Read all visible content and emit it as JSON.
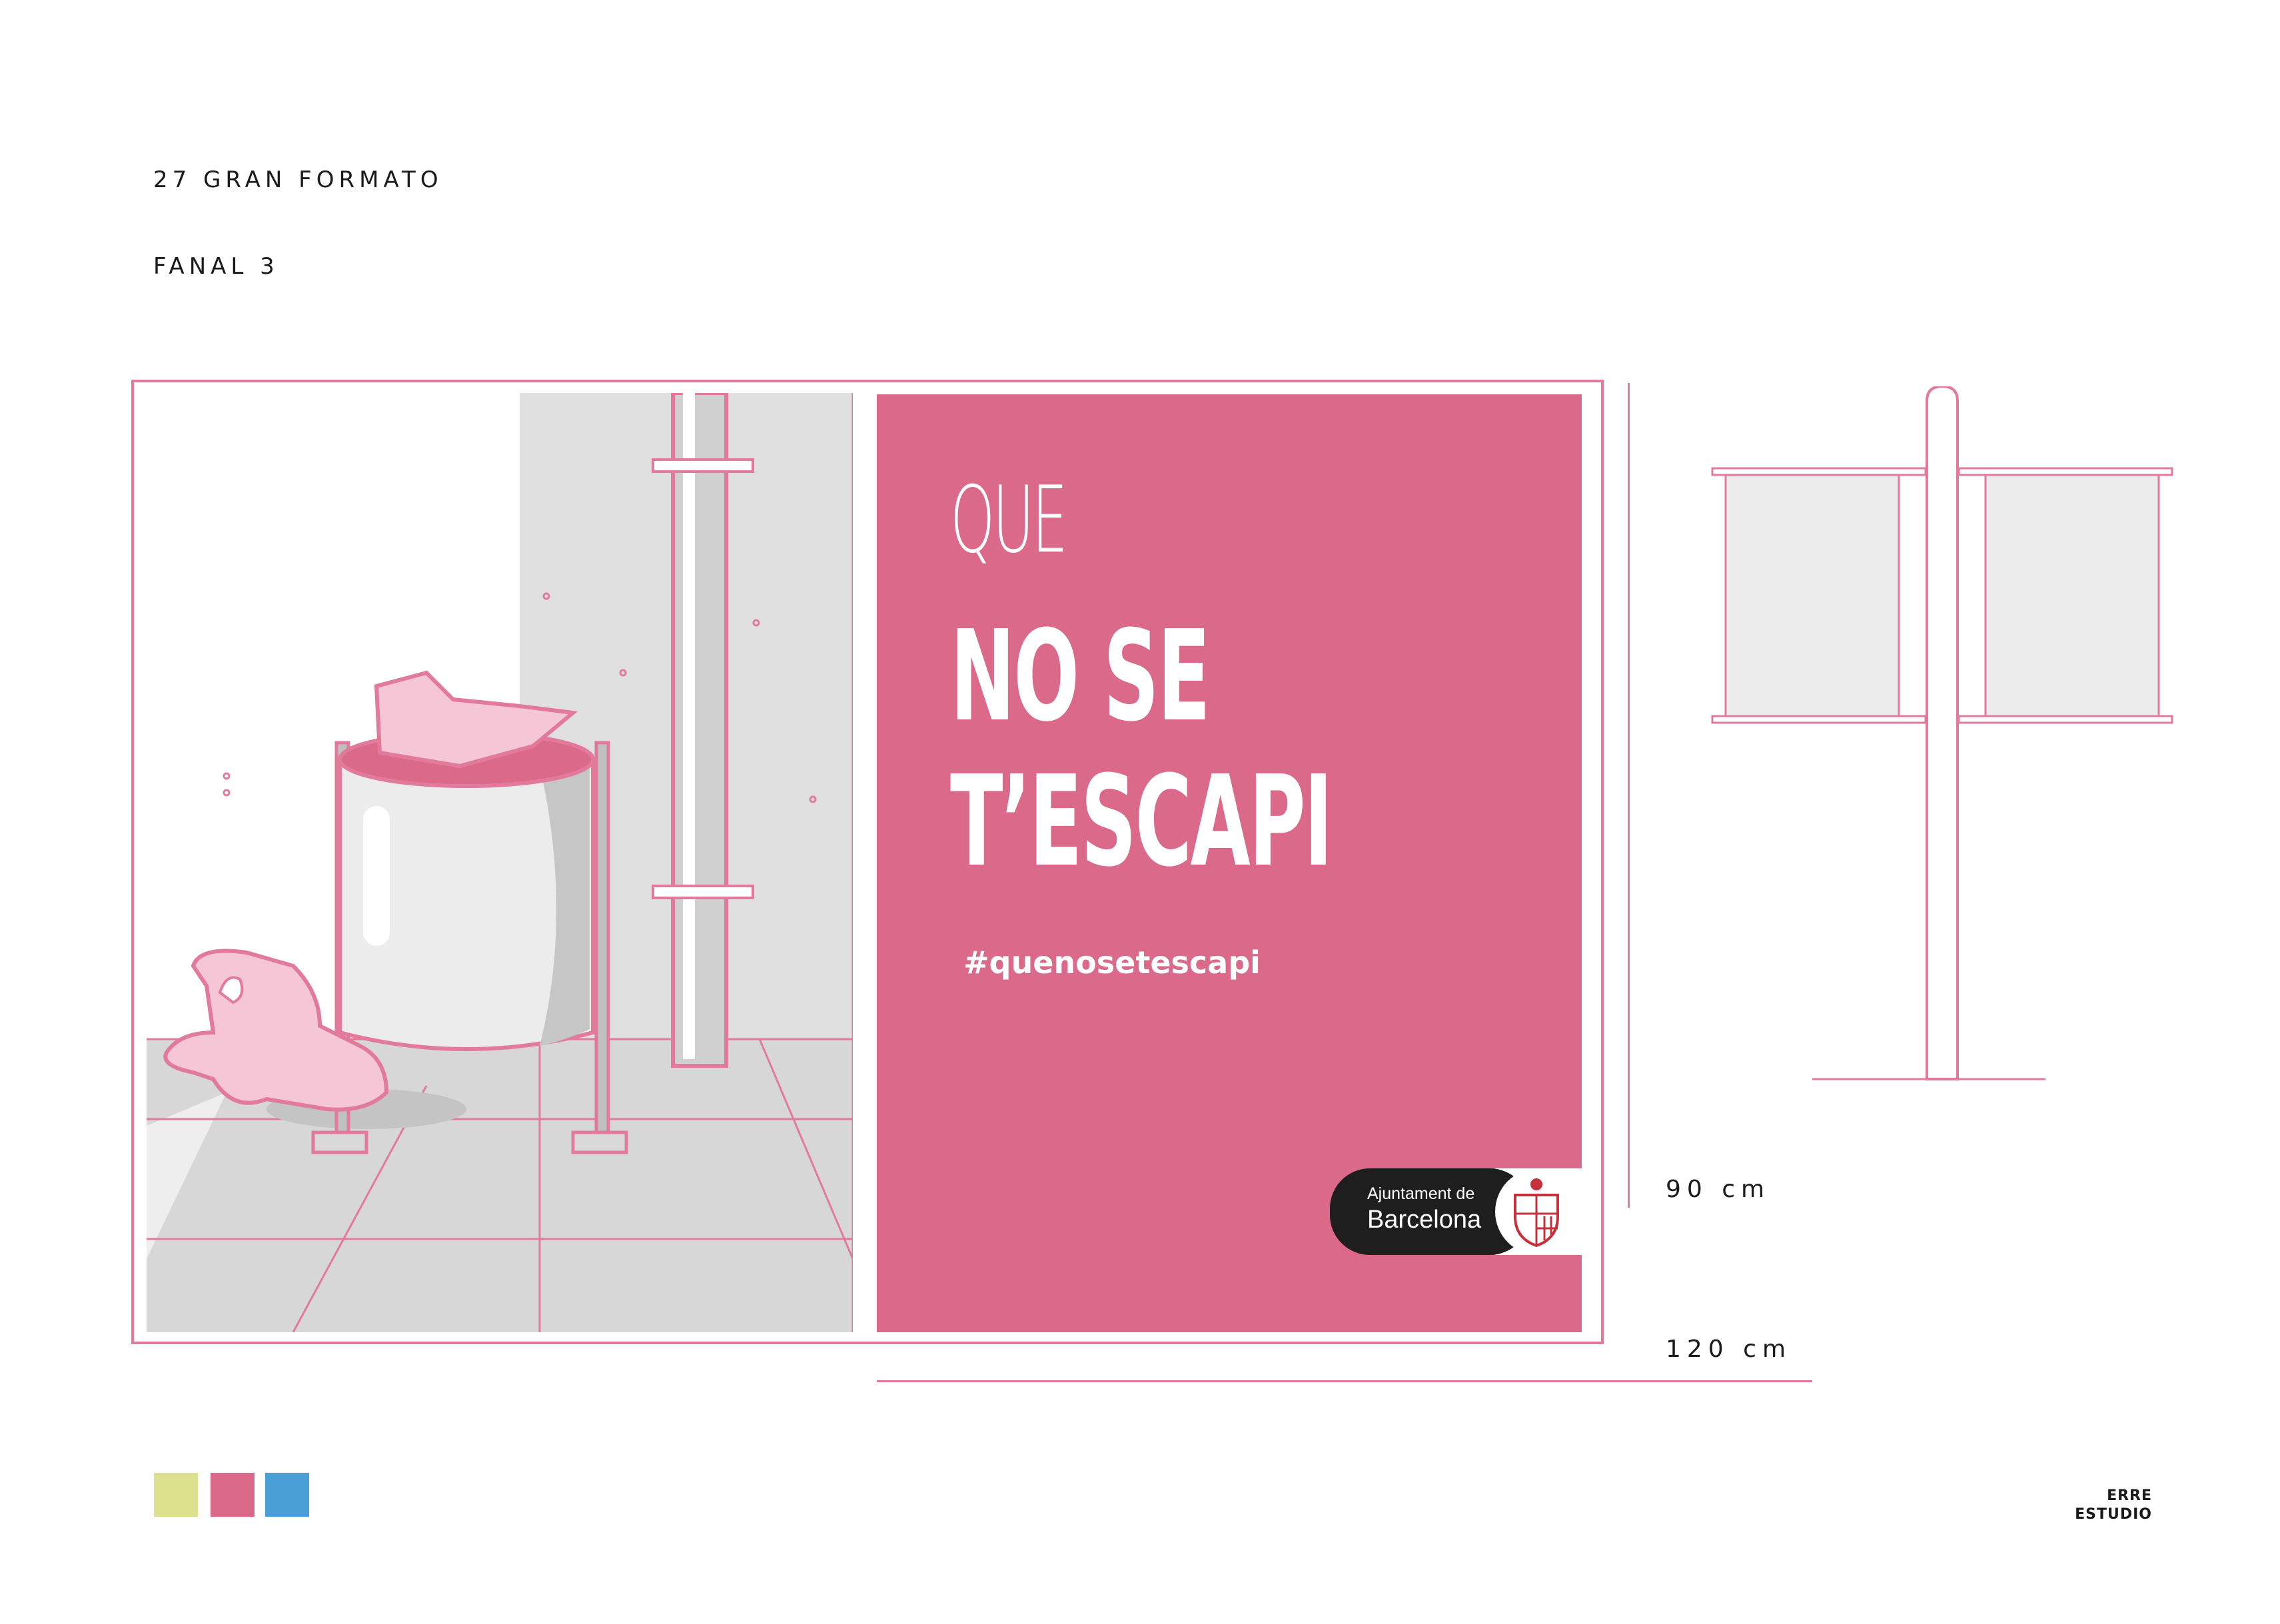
{
  "header": {
    "section_title": "27 GRAN FORMATO",
    "item_title": "FANAL 3"
  },
  "poster": {
    "line1": "QUE",
    "line2": "NO SE",
    "line3": "T’ESCAPI",
    "hashtag": "#quenosetescapi",
    "logo": {
      "small_text": "Ajuntament de",
      "big_text": "Barcelona"
    }
  },
  "dimensions": {
    "height": "90 cm",
    "width": "120 cm"
  },
  "palette": {
    "colors": [
      "#dde08f",
      "#db6a8a",
      "#4a9fd6"
    ]
  },
  "studio": {
    "line1": "ERRE",
    "line2": "ESTUDIO"
  }
}
